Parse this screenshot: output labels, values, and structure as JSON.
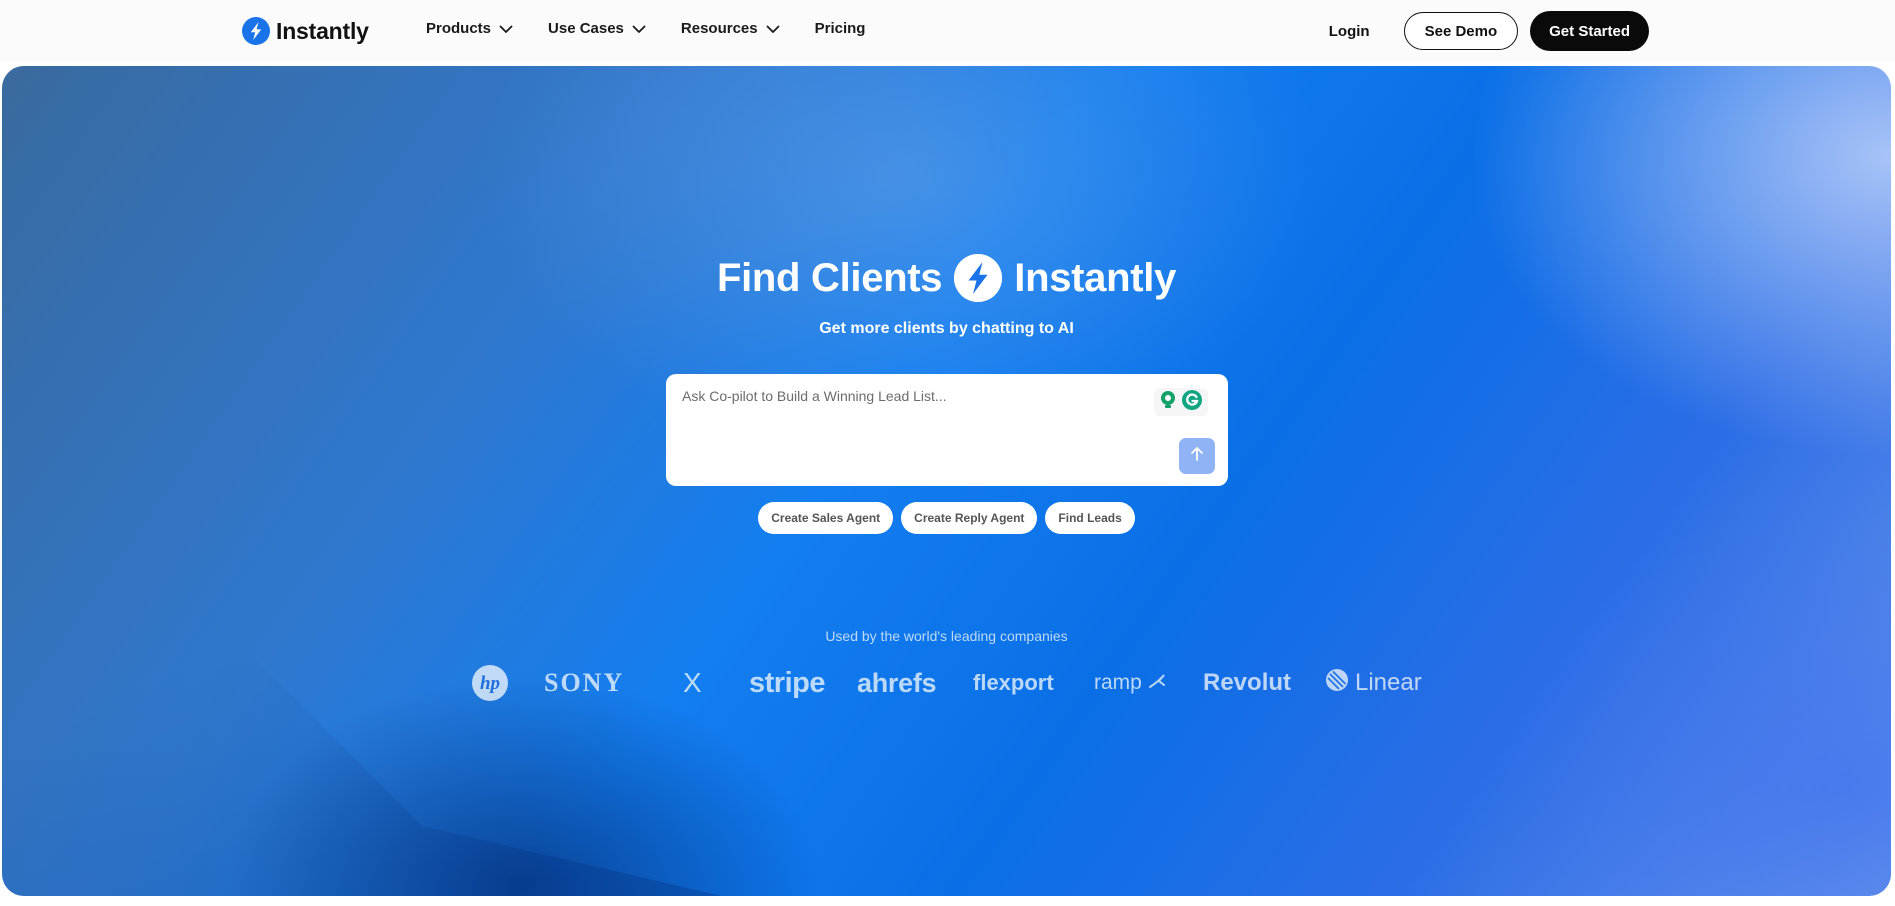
{
  "brand": {
    "name": "Instantly",
    "accent": "#1a73e8"
  },
  "nav": {
    "items": [
      {
        "label": "Products",
        "has_dropdown": true
      },
      {
        "label": "Use Cases",
        "has_dropdown": true
      },
      {
        "label": "Resources",
        "has_dropdown": true
      },
      {
        "label": "Pricing",
        "has_dropdown": false
      }
    ],
    "login_label": "Login",
    "demo_label": "See Demo",
    "get_started_label": "Get Started"
  },
  "hero": {
    "title_left": "Find Clients",
    "title_right": "Instantly",
    "subtitle": "Get more clients by chatting to AI",
    "prompt_placeholder": "Ask Co-pilot to Build a Winning Lead List...",
    "chips": [
      "Create Sales Agent",
      "Create Reply Agent",
      "Find Leads"
    ],
    "used_by": "Used by the world's leading companies",
    "companies": [
      "hp",
      "SONY",
      "X",
      "stripe",
      "ahrefs",
      "flexport",
      "ramp",
      "Revolut",
      "Linear"
    ]
  },
  "colors": {
    "hero_blue": "#137ef0",
    "send_button": "#8fb3f5",
    "dark_button": "#0a0a0a"
  }
}
